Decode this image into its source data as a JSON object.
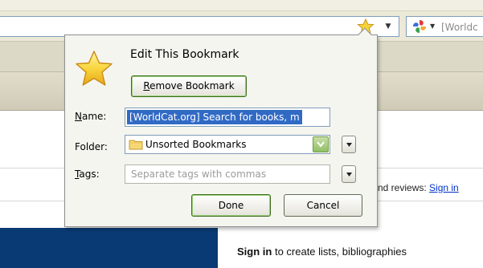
{
  "browser": {
    "search_placeholder": "[Worldc"
  },
  "page": {
    "reviews_text": "nd reviews: ",
    "sign_in_link": "Sign in",
    "sign_in_bold": "Sign in",
    "sign_in_rest": " to create lists, bibliographies"
  },
  "dialog": {
    "title": "Edit This Bookmark",
    "remove_button": {
      "accel": "R",
      "rest": "emove Bookmark"
    },
    "name_label": {
      "accel": "N",
      "rest": "ame:"
    },
    "name_value": "[WorldCat.org] Search for books, m",
    "folder_label": "Folder:",
    "folder_value": "Unsorted Bookmarks",
    "tags_label": {
      "accel": "T",
      "rest": "ags:"
    },
    "tags_placeholder": "Separate tags with commas",
    "done_button": "Done",
    "cancel_button": "Cancel"
  },
  "colors": {
    "selection": "#316ac5",
    "button_border": "#3c6e1e",
    "page_banner": "#0a3a73",
    "link": "#0033cc"
  }
}
